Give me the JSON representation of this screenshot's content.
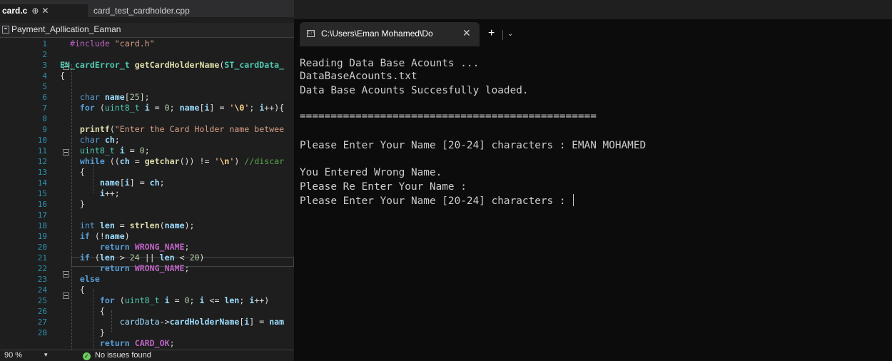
{
  "ide": {
    "tabs": [
      {
        "label": "card.c",
        "pin": "⊕",
        "close": "✕"
      },
      {
        "label": "card_test_cardholder.cpp"
      }
    ],
    "nav": {
      "project": "Payment_Apllication_Eaman"
    },
    "line_numbers": [
      "1",
      "2",
      "3",
      "4",
      "5",
      "6",
      "7",
      "8",
      "9",
      "10",
      "11",
      "12",
      "13",
      "14",
      "15",
      "16",
      "17",
      "18",
      "19",
      "20",
      "21",
      "22",
      "23",
      "24",
      "25",
      "26",
      "27",
      "28"
    ],
    "status": {
      "zoom": "90 %",
      "zoom_caret": "▾",
      "issues": "No issues found"
    }
  },
  "terminal": {
    "tab_title": "C:\\Users\\Eman Mohamed\\Do",
    "tab_close": "✕",
    "new_tab": "+",
    "dropdown": "⌄",
    "lines": [
      "Reading Data Base Acounts ...",
      "DataBaseAcounts.txt",
      "Data Base Acounts Succesfully loaded.",
      "================================================",
      "Please Enter Your Name [20-24] characters : EMAN MOHAMED",
      "You Entered Wrong Name.",
      "Please Re Enter Your Name :",
      "Please Enter Your Name [20-24] characters : "
    ]
  }
}
